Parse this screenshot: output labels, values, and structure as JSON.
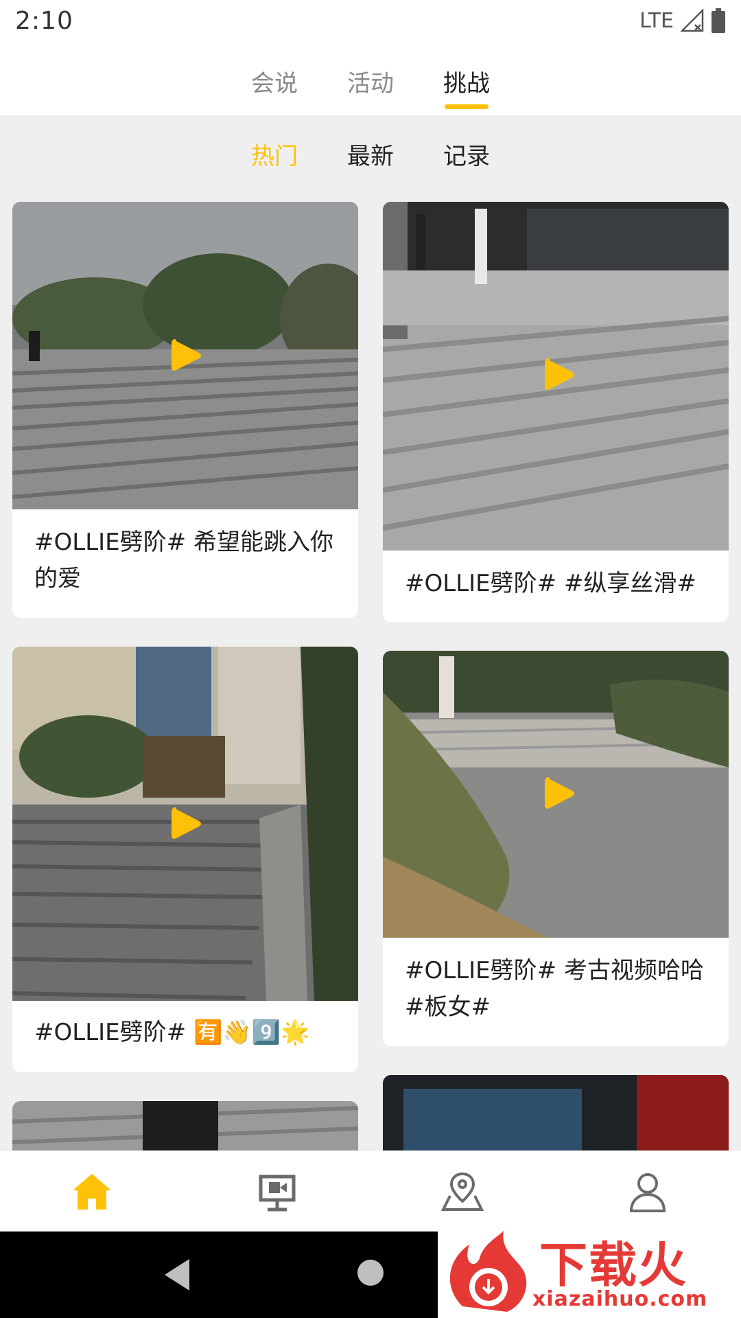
{
  "status_bar": {
    "time": "2:10",
    "network": "LTE"
  },
  "top_tabs": [
    {
      "label": "会说",
      "active": false
    },
    {
      "label": "活动",
      "active": false
    },
    {
      "label": "挑战",
      "active": true
    }
  ],
  "sub_tabs": [
    {
      "label": "热门",
      "active": true
    },
    {
      "label": "最新",
      "active": false
    },
    {
      "label": "记录",
      "active": false
    }
  ],
  "cards": [
    {
      "text": "#OLLIE劈阶# 希望能跳入你的爱",
      "image": "skateboarder at top of wide outdoor stairs with trees"
    },
    {
      "text": "#OLLIE劈阶# #纵享丝滑#",
      "image": "skateboarder on stone steps near glass building"
    },
    {
      "text": "#OLLIE劈阶# 🈶👋9️⃣🌟",
      "image": "outdoor stairs in front of hotel buildings"
    },
    {
      "text": "#OLLIE劈阶# 考古视频哈哈#板女#",
      "image": "skater on low steps in garden plaza"
    }
  ],
  "bottom_nav": [
    {
      "icon": "home-icon",
      "active": true
    },
    {
      "icon": "video-board-icon",
      "active": false
    },
    {
      "icon": "map-pin-icon",
      "active": false
    },
    {
      "icon": "profile-icon",
      "active": false
    }
  ],
  "watermark": {
    "title": "下载火",
    "url": "xiazaihuo.com"
  },
  "colors": {
    "accent": "#ffc107",
    "text": "#222222",
    "muted": "#8a8a8a",
    "background": "#efefef"
  }
}
